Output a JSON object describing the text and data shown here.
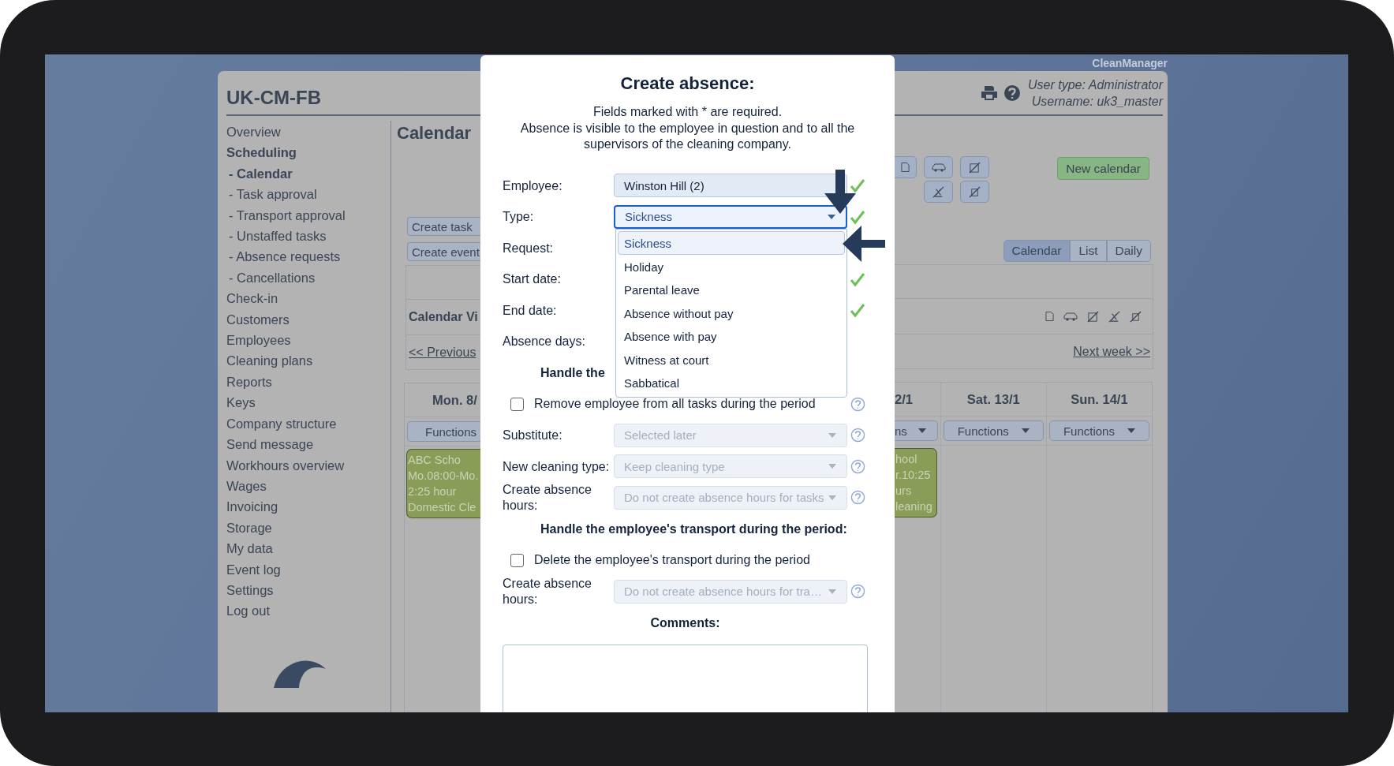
{
  "app_name": "CleanManager",
  "header": {
    "title": "UK-CM-FB",
    "user_type": "User type: Administrator",
    "username": "Username: uk3_master"
  },
  "sidebar": {
    "items": [
      {
        "label": "Overview",
        "selected": false
      },
      {
        "label": "Scheduling",
        "selected": true,
        "children": [
          {
            "label": "- Calendar",
            "selected": true
          },
          {
            "label": "- Task approval",
            "selected": false
          },
          {
            "label": "- Transport approval",
            "selected": false
          },
          {
            "label": "- Unstaffed tasks",
            "selected": false
          },
          {
            "label": "- Absence requests",
            "selected": false
          },
          {
            "label": "- Cancellations",
            "selected": false
          }
        ]
      },
      {
        "label": "Check-in",
        "selected": false
      },
      {
        "label": "Customers",
        "selected": false
      },
      {
        "label": "Employees",
        "selected": false
      },
      {
        "label": "Cleaning plans",
        "selected": false
      },
      {
        "label": "Reports",
        "selected": false
      },
      {
        "label": "Keys",
        "selected": false
      },
      {
        "label": "Company structure",
        "selected": false
      },
      {
        "label": "Send message",
        "selected": false
      },
      {
        "label": "Workhours overview",
        "selected": false
      },
      {
        "label": "Wages",
        "selected": false
      },
      {
        "label": "Invoicing",
        "selected": false
      },
      {
        "label": "Storage",
        "selected": false
      },
      {
        "label": "My data",
        "selected": false
      },
      {
        "label": "Event log",
        "selected": false
      },
      {
        "label": "Settings",
        "selected": false
      },
      {
        "label": "Log out",
        "selected": false
      }
    ]
  },
  "calendar": {
    "title": "Calendar",
    "create_buttons": [
      "Create task",
      "Create event"
    ],
    "new_calendar": "New calendar",
    "view_tabs": [
      {
        "label": "Calendar",
        "selected": true
      },
      {
        "label": "List",
        "selected": false
      },
      {
        "label": "Daily",
        "selected": false
      }
    ],
    "view_title": "Calendar Vi",
    "previous": "<< Previous",
    "next": "Next week >>",
    "days": [
      {
        "heading": "Mon. 8/",
        "functions": "Functions",
        "event": [
          "ABC Scho",
          "Mo.08:00-Mo.",
          "2:25 hour",
          "Domestic Cle"
        ]
      },
      {
        "heading": "2/1",
        "functions": "ns",
        "event": [
          "hool",
          "r.10:25",
          "urs",
          "leaning"
        ]
      },
      {
        "heading": "Sat. 13/1",
        "functions": "Functions"
      },
      {
        "heading": "Sun. 14/1",
        "functions": "Functions"
      }
    ]
  },
  "dialog": {
    "title": "Create absence:",
    "notes": [
      "Fields marked with * are required.",
      "Absence is visible to the employee in question and to all the supervisors of the cleaning company."
    ],
    "rows": [
      {
        "kind": "select",
        "label": "Employee:",
        "value": "Winston Hill (2)",
        "valid": true,
        "disabled": false
      },
      {
        "kind": "select",
        "label": "Type:",
        "value": "Sickness",
        "valid": true,
        "disabled": false,
        "focused": true,
        "options": [
          {
            "label": "Sickness",
            "selected": true
          },
          {
            "label": "Holiday",
            "selected": false
          },
          {
            "label": "Parental leave",
            "selected": false
          },
          {
            "label": "Absence without pay",
            "selected": false
          },
          {
            "label": "Absence with pay",
            "selected": false
          },
          {
            "label": "Witness at court",
            "selected": false
          },
          {
            "label": "Sabbatical",
            "selected": false
          }
        ]
      },
      {
        "kind": "covered",
        "label": "Request:"
      },
      {
        "kind": "covered",
        "label": "Start date:",
        "valid": true
      },
      {
        "kind": "covered",
        "label": "End date:",
        "valid": true
      },
      {
        "kind": "covered",
        "label": "Absence days:",
        "valid": false
      },
      {
        "kind": "section",
        "text": "Handle the"
      },
      {
        "kind": "checkbox",
        "label": "Remove employee from all tasks during the period",
        "checked": false,
        "help": true
      },
      {
        "kind": "select",
        "label": "Substitute:",
        "value": "Selected later",
        "disabled": true,
        "help": true
      },
      {
        "kind": "select",
        "label": "New cleaning type:",
        "value": "Keep cleaning type",
        "disabled": true,
        "help": true
      },
      {
        "kind": "select",
        "label": "Create absence hours:",
        "value": "Do not create absence hours for tasks",
        "disabled": true,
        "help": true
      },
      {
        "kind": "section",
        "text": "Handle the employee's transport during the period:"
      },
      {
        "kind": "checkbox",
        "label": "Delete the employee's transport during the period",
        "checked": false,
        "help": false
      },
      {
        "kind": "select",
        "label": "Create absence hours:",
        "value": "Do not create absence hours for tra…",
        "disabled": true,
        "help": true
      },
      {
        "kind": "caption",
        "text": "Comments:"
      },
      {
        "kind": "textarea"
      }
    ]
  }
}
